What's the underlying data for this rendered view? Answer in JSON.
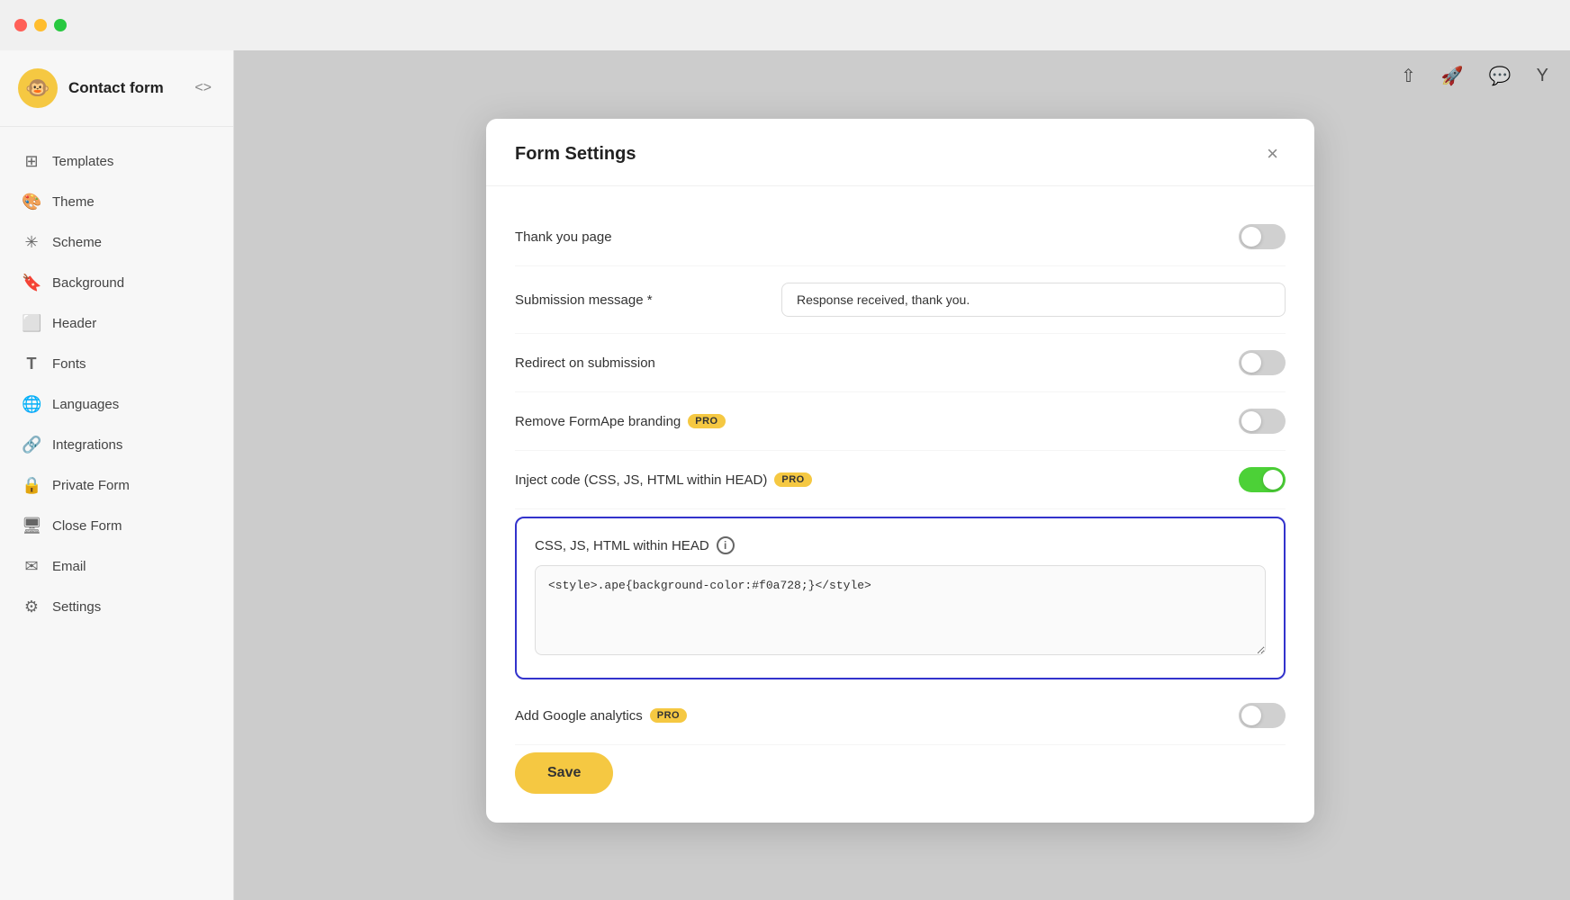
{
  "titlebar": {
    "buttons": [
      "close",
      "minimize",
      "maximize"
    ]
  },
  "sidebar": {
    "logo_emoji": "🐵",
    "app_name": "Contact form",
    "collapse_icon": "<>",
    "nav_items": [
      {
        "id": "templates",
        "label": "Templates",
        "icon": "⊞"
      },
      {
        "id": "theme",
        "label": "Theme",
        "icon": "🎨"
      },
      {
        "id": "scheme",
        "label": "Scheme",
        "icon": "✳"
      },
      {
        "id": "background",
        "label": "Background",
        "icon": "🔖"
      },
      {
        "id": "header",
        "label": "Header",
        "icon": "⬜"
      },
      {
        "id": "fonts",
        "label": "Fonts",
        "icon": "T"
      },
      {
        "id": "languages",
        "label": "Languages",
        "icon": "🌐"
      },
      {
        "id": "integrations",
        "label": "Integrations",
        "icon": "🔗"
      },
      {
        "id": "private-form",
        "label": "Private Form",
        "icon": "🔒"
      },
      {
        "id": "close-form",
        "label": "Close Form",
        "icon": "🖥"
      },
      {
        "id": "email",
        "label": "Email",
        "icon": "✉"
      },
      {
        "id": "settings",
        "label": "Settings",
        "icon": "⚙"
      }
    ]
  },
  "toolbar_icons": [
    "upload",
    "rocket",
    "message",
    "user"
  ],
  "modal": {
    "title": "Form Settings",
    "close_label": "×",
    "rows": [
      {
        "id": "thank-you-page",
        "label": "Thank you page",
        "type": "toggle",
        "enabled": false
      },
      {
        "id": "submission-message",
        "label": "Submission message *",
        "type": "input",
        "value": "Response received, thank you."
      },
      {
        "id": "redirect-on-submission",
        "label": "Redirect on submission",
        "type": "toggle",
        "enabled": false
      },
      {
        "id": "remove-formape-branding",
        "label": "Remove FormApe branding",
        "type": "toggle",
        "enabled": false,
        "badge": "PRO"
      },
      {
        "id": "inject-code",
        "label": "Inject code (CSS, JS, HTML within HEAD)",
        "type": "toggle",
        "enabled": true,
        "badge": "PRO"
      }
    ],
    "code_section": {
      "title": "CSS, JS, HTML within HEAD",
      "info_tooltip": "i",
      "code_value": "<style>.ape{background-color:#f0a728;}</style>"
    },
    "add_google_analytics": {
      "label": "Add Google analytics",
      "badge": "PRO",
      "enabled": false
    },
    "save_button": "Save"
  }
}
